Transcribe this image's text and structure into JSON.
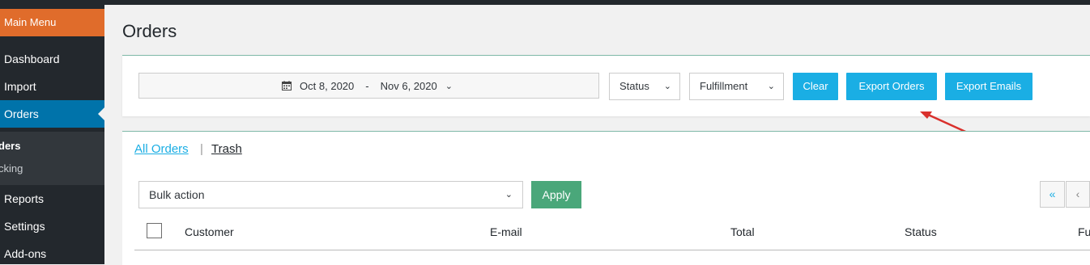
{
  "sidebar": {
    "main_menu": "Main Menu",
    "items": [
      {
        "label": "Dashboard"
      },
      {
        "label": "Import"
      },
      {
        "label": "Orders"
      }
    ],
    "submenu": [
      {
        "label": "ders"
      },
      {
        "label": "cking"
      }
    ],
    "bottom_items": [
      {
        "label": "Reports"
      },
      {
        "label": "Settings"
      },
      {
        "label": "Add-ons"
      }
    ]
  },
  "page": {
    "title": "Orders"
  },
  "filters": {
    "date_from": "Oct 8, 2020",
    "date_sep": "-",
    "date_to": "Nov 6, 2020",
    "status_label": "Status",
    "fulfillment_label": "Fulfillment",
    "clear_label": "Clear",
    "export_orders_label": "Export Orders",
    "export_emails_label": "Export Emails"
  },
  "views": {
    "all": "All Orders",
    "separator": "|",
    "trash": "Trash"
  },
  "bulk": {
    "selected": "Bulk action",
    "apply_label": "Apply"
  },
  "pagination": {
    "first": "«",
    "prev": "‹"
  },
  "table": {
    "columns": [
      "Customer",
      "E-mail",
      "Total",
      "Status",
      "Fu"
    ]
  },
  "colors": {
    "accent": "#1aaee4",
    "apply": "#4aa77a",
    "main_menu": "#e06c2b",
    "sidebar_active": "#0073aa",
    "annotation_arrow": "#d9302c"
  },
  "icons": {
    "calendar": "calendar-icon",
    "chevron": "chevron-down-icon",
    "arrow": "annotation-arrow"
  }
}
